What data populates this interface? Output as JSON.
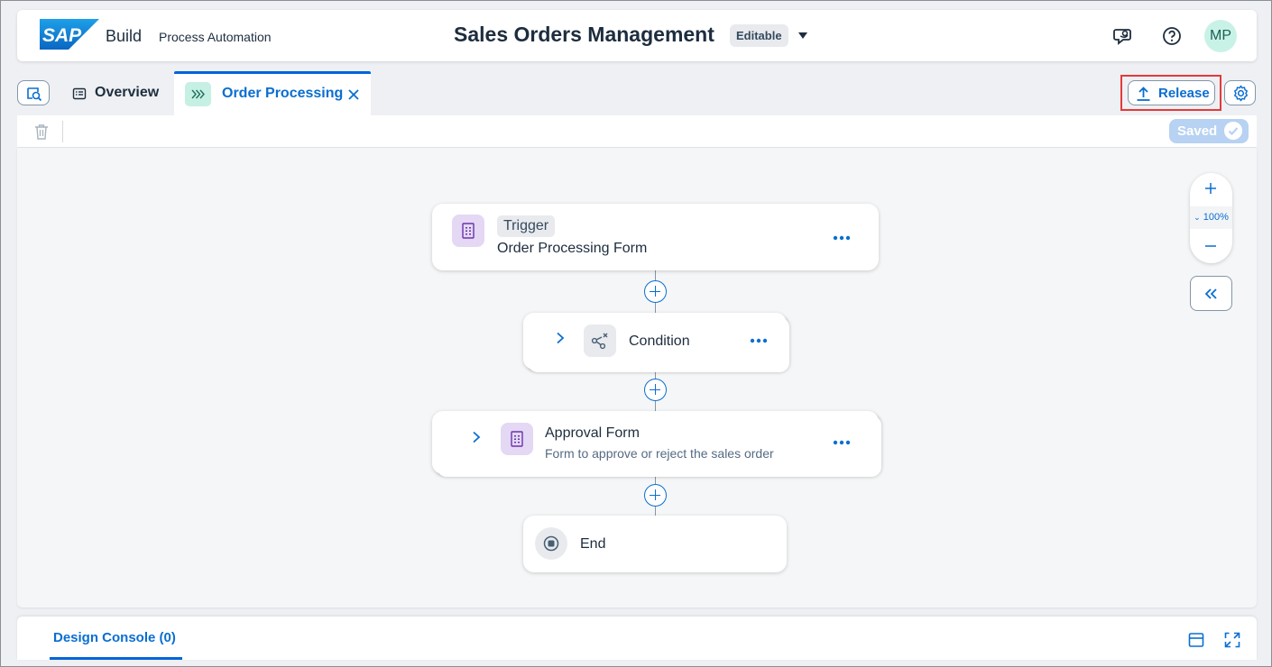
{
  "shell": {
    "logo_text": "SAP",
    "brand": "Build",
    "product": "Process Automation",
    "project_title": "Sales Orders Management",
    "status_badge": "Editable",
    "avatar_initials": "MP",
    "icons": [
      "feedback-icon",
      "help-icon"
    ]
  },
  "tabs": {
    "overview_label": "Overview",
    "active_label": "Order Processing"
  },
  "actions": {
    "release_label": "Release",
    "saved_label": "Saved"
  },
  "flow": {
    "trigger": {
      "chip": "Trigger",
      "title": "Order Processing Form"
    },
    "condition": {
      "title": "Condition"
    },
    "approval": {
      "title": "Approval Form",
      "subtitle": "Form to approve or reject the sales order"
    },
    "end": {
      "title": "End"
    }
  },
  "zoom": {
    "value": "100%"
  },
  "console": {
    "tab_label": "Design Console (0)"
  },
  "colors": {
    "accent": "#0a6ed1",
    "highlight": "#e33a3a",
    "form_icon_bg": "#e4d8f5",
    "sap_blue": "#0a72c9"
  }
}
